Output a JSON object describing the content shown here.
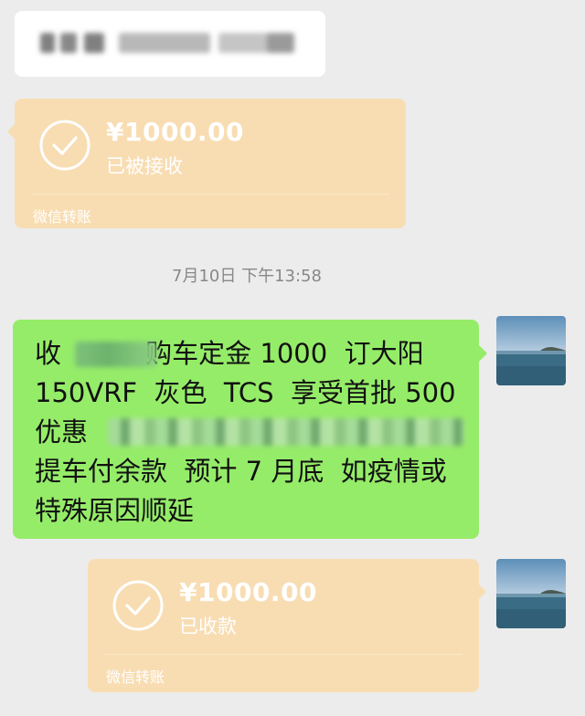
{
  "chat": {
    "transfers": [
      {
        "amount": "¥1000.00",
        "status": "已被接收",
        "footer": "微信转账",
        "icon": "check-circle-icon"
      },
      {
        "amount": "¥1000.00",
        "status": "已收款",
        "footer": "微信转账",
        "icon": "check-circle-icon"
      }
    ],
    "timestamp": "7月10日 下午13:58",
    "message": "收          购车定金 1000  订大阳\n150VRF  灰色  TCS  享受首批 500\n优惠\n提车付余款  预计 7 月底  如疫情或\n特殊原因顺延"
  },
  "colors": {
    "background": "#ececec",
    "transfer_card": "#f8ddb3",
    "sent_bubble": "#95ec69",
    "received_bubble": "#ffffff",
    "timestamp_text": "#888888"
  }
}
